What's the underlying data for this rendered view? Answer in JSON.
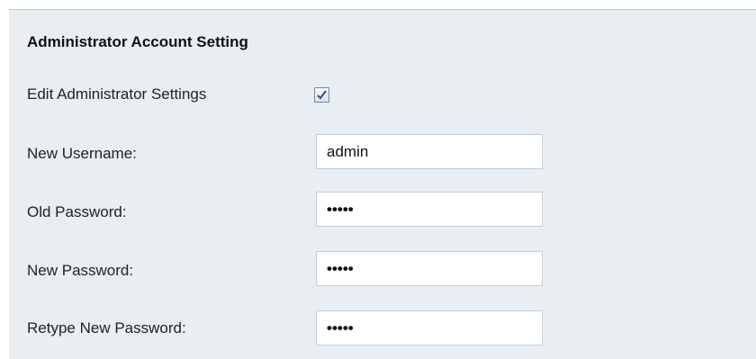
{
  "section": {
    "title": "Administrator Account Setting"
  },
  "edit_settings": {
    "label": "Edit Administrator Settings",
    "checked": true
  },
  "fields": {
    "new_username": {
      "label": "New Username:",
      "value": "admin"
    },
    "old_password": {
      "label": "Old Password:",
      "value": "•••••"
    },
    "new_password": {
      "label": "New Password:",
      "value": "•••••"
    },
    "retype_password": {
      "label": "Retype New Password:",
      "value": "•••••"
    }
  },
  "colors": {
    "panel_background": "#e8eef2",
    "checkmark": "#2a4f8a"
  }
}
